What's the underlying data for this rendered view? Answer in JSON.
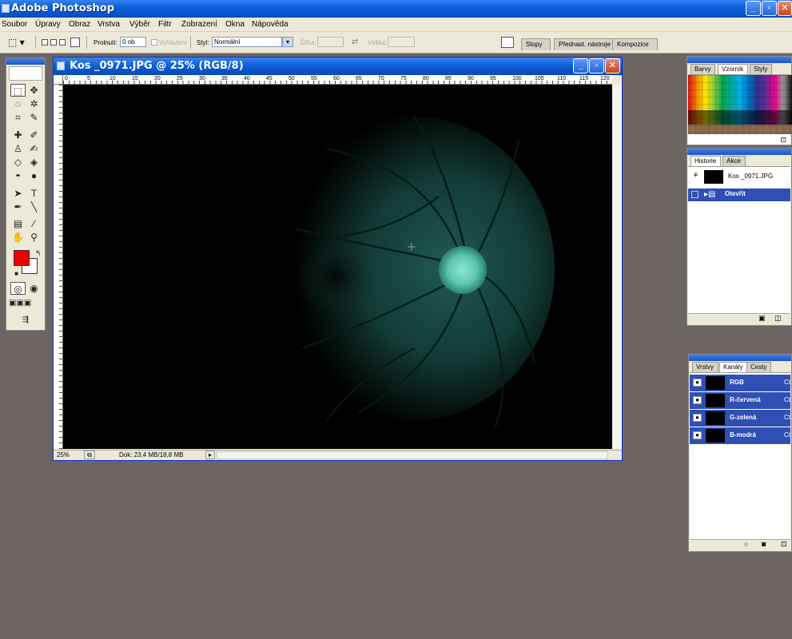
{
  "app": {
    "title": "Adobe Photoshop",
    "window_buttons": [
      "_",
      "▫",
      "✕"
    ]
  },
  "menu": [
    "Soubor",
    "Úpravy",
    "Obraz",
    "Vrstva",
    "Výběr",
    "Filtr",
    "Zobrazení",
    "Okna",
    "Nápověda"
  ],
  "options": {
    "feather_label": "Prolnutí:",
    "feather_value": "0 ob",
    "antialias_label": "Vyhlazení",
    "style_label": "Styl:",
    "style_value": "Normální",
    "width_label": "Šířka:",
    "height_label": "Výška:",
    "well_tabs": [
      "Stopy",
      "Přednast. nástroje",
      "Kompozice"
    ]
  },
  "document": {
    "title": "Kos _0971.JPG @ 25% (RGB/8)",
    "ruler_h": [
      "0",
      "5",
      "10",
      "15",
      "20",
      "25",
      "30",
      "35",
      "40",
      "45",
      "50",
      "55",
      "60",
      "65",
      "70",
      "75",
      "80",
      "85",
      "90",
      "95",
      "100",
      "105",
      "110",
      "115",
      "120"
    ],
    "zoom": "25%",
    "doc_size": "Dok: 23,4 MB/18,8 MB"
  },
  "swatches_panel": {
    "tabs": [
      "Barvy",
      "Vzorník",
      "Styly"
    ]
  },
  "history_panel": {
    "tabs": [
      "Historie",
      "Akce"
    ],
    "snapshot": "Kos _0971.JPG",
    "step": "Otevřít"
  },
  "layers_panel": {
    "tabs": [
      "Vrstvy",
      "Kanály",
      "Cesty"
    ],
    "channels": [
      {
        "name": "RGB",
        "shortcut": "Ct"
      },
      {
        "name": "R-červená",
        "shortcut": "Ct"
      },
      {
        "name": "G-zelená",
        "shortcut": "Ct"
      },
      {
        "name": "B-modrá",
        "shortcut": "Ct"
      }
    ]
  },
  "colors": {
    "foreground": "#ee0000",
    "background": "#ffffff",
    "desktop": "#6d6563",
    "selection": "#2f4fb4"
  }
}
